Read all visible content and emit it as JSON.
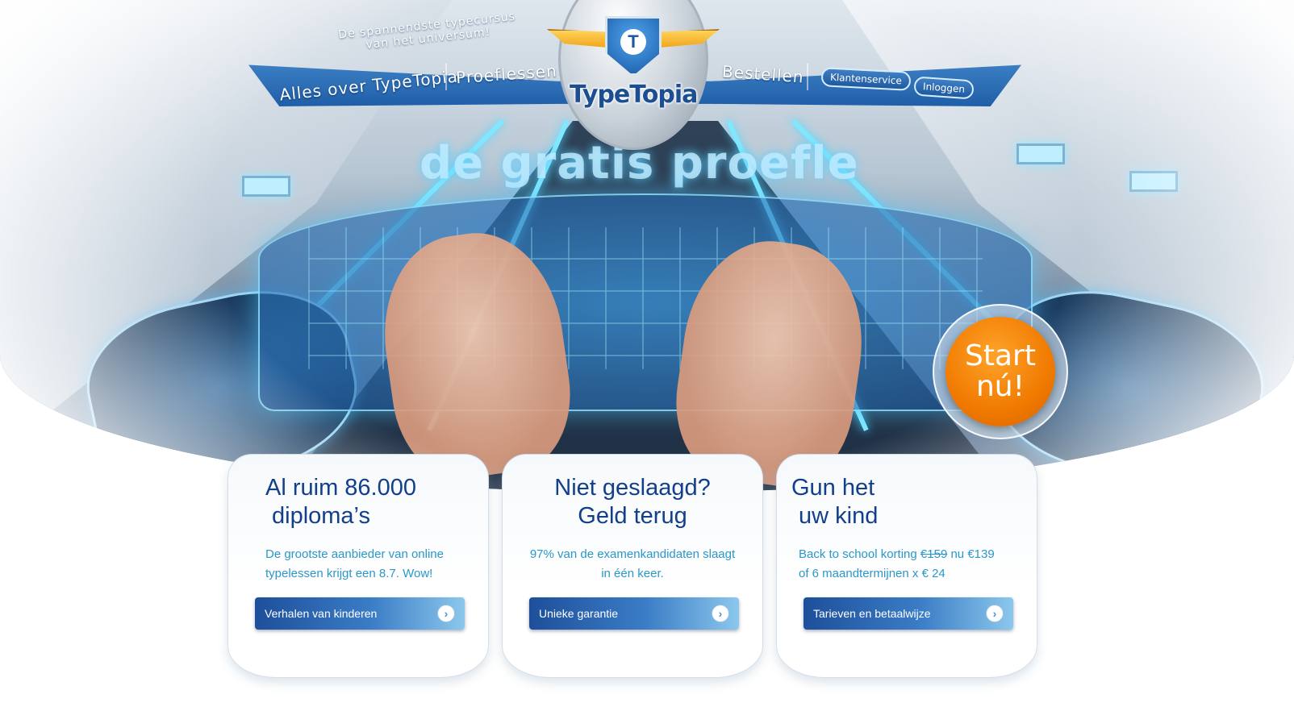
{
  "header": {
    "tagline_line1": "De spannendste typecursus",
    "tagline_line2": "van het universum!",
    "nav": {
      "about": "Alles over TypeTopia",
      "trial": "Proeflessen",
      "order": "Bestellen"
    },
    "customer_service": "Klantenservice",
    "login": "Inloggen"
  },
  "logo": {
    "wordmark": "TypeTopia",
    "emblem_letter": "T"
  },
  "hero": {
    "text": "de gratis proefle",
    "start_line1": "Start",
    "start_line2": "nú!"
  },
  "panels": [
    {
      "title_line1": "Al ruim 86.000",
      "title_line2": "diploma’s",
      "text": "De grootste aanbieder van online typelessen krijgt een 8.7. Wow!",
      "button": "Verhalen van kinderen"
    },
    {
      "title_line1": "Niet geslaagd?",
      "title_line2": "Geld terug",
      "text": "97% van de examenkandidaten slaagt in één keer.",
      "button": "Unieke garantie"
    },
    {
      "title_line1": "Gun het",
      "title_line2": "uw kind",
      "text_prefix": "Back to school korting",
      "old_price": "€159",
      "text_suffix": "nu €139",
      "text_line2": "of 6 maandtermijnen x € 24",
      "button": "Tarieven en betaalwijze"
    }
  ],
  "icons": {
    "arrow": "chevron-right-icon"
  },
  "colors": {
    "nav_blue": "#1f5ea8",
    "heading_blue": "#123f8a",
    "body_cyan": "#2b97c8",
    "start_orange": "#f07a00"
  }
}
